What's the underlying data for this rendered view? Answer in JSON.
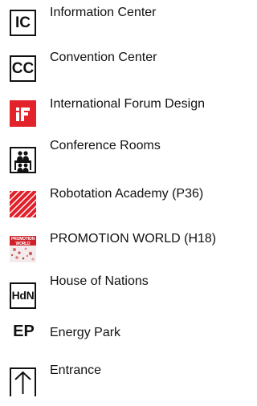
{
  "legend": [
    {
      "icon": "information-center-icon",
      "badge": "IC",
      "label": "Information Center"
    },
    {
      "icon": "convention-center-icon",
      "badge": "CC",
      "label": "Convention Center"
    },
    {
      "icon": "international-forum-design-logo",
      "badge": "",
      "label": "International Forum Design"
    },
    {
      "icon": "conference-rooms-icon",
      "badge": "",
      "label": "Conference Rooms"
    },
    {
      "icon": "robotation-academy-hatch-icon",
      "badge": "",
      "label": "Robotation Academy (P36)"
    },
    {
      "icon": "promotion-world-logo",
      "badge": "PROMOTION WORLD",
      "label": "PROMOTION WORLD (H18)"
    },
    {
      "icon": "house-of-nations-icon",
      "badge": "HdN",
      "label": "House of Nations"
    },
    {
      "icon": "energy-park-icon",
      "badge": "EP",
      "label": "Energy Park"
    },
    {
      "icon": "entrance-arrow-icon",
      "badge": "",
      "label": "Entrance"
    }
  ],
  "colors": {
    "if_red": "#e3232b",
    "hatch_red": "#e0202a",
    "promotion_red": "#d0202a",
    "text": "#111111"
  }
}
